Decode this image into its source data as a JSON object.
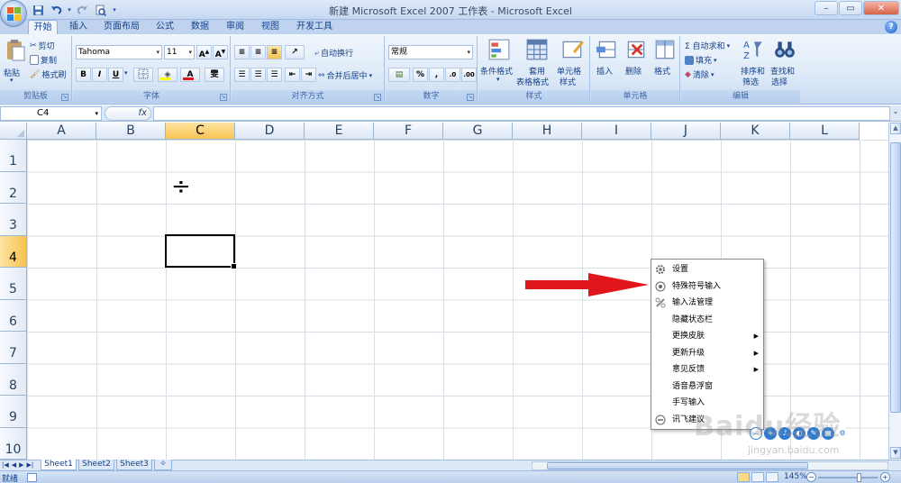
{
  "window": {
    "title": "新建 Microsoft Excel 2007 工作表 - Microsoft Excel",
    "minimize": "–",
    "restore": "▭",
    "close": "✕"
  },
  "qat": {
    "save": "💾",
    "undo": "↶",
    "redo": "↷",
    "print": "🖨",
    "customize": "▾"
  },
  "tabs": [
    {
      "label": "开始",
      "active": true
    },
    {
      "label": "插入"
    },
    {
      "label": "页面布局"
    },
    {
      "label": "公式"
    },
    {
      "label": "数据"
    },
    {
      "label": "审阅"
    },
    {
      "label": "视图"
    },
    {
      "label": "开发工具"
    }
  ],
  "ribbon": {
    "clipboard": {
      "label": "剪贴板",
      "paste": "粘贴",
      "cut": "剪切",
      "copy": "复制",
      "format_painter": "格式刷"
    },
    "font": {
      "label": "字体",
      "name": "Tahoma",
      "size": "11",
      "grow": "A^",
      "shrink": "A˅",
      "bold": "B",
      "italic": "I",
      "underline": "U",
      "wen": "雯"
    },
    "alignment": {
      "label": "对齐方式",
      "wrap": "自动换行",
      "merge": "合并后居中"
    },
    "number": {
      "label": "数字",
      "format": "常规",
      "percent": "%",
      "comma": ","
    },
    "styles": {
      "label": "样式",
      "conditional": "条件格式",
      "table_line1": "套用",
      "table_line2": "表格格式",
      "cell_line1": "单元格",
      "cell_line2": "样式"
    },
    "cells": {
      "label": "单元格",
      "insert": "插入",
      "delete": "删除",
      "format": "格式"
    },
    "editing": {
      "label": "编辑",
      "autosum": "Σ 自动求和",
      "fill": "填充",
      "clear": "清除",
      "sort_line1": "排序和",
      "sort_line2": "筛选",
      "find_line1": "查找和",
      "find_line2": "选择"
    }
  },
  "formula_bar": {
    "name_box": "C4",
    "fx": "fx",
    "value": ""
  },
  "columns": [
    "A",
    "B",
    "C",
    "D",
    "E",
    "F",
    "G",
    "H",
    "I",
    "J",
    "K",
    "L"
  ],
  "rows": [
    "1",
    "2",
    "3",
    "4",
    "5",
    "6",
    "7",
    "8",
    "9",
    "10"
  ],
  "selected_cell": {
    "column": "C",
    "row": "4"
  },
  "cell_content": {
    "C2": "÷"
  },
  "sheets": [
    {
      "label": "Sheet1",
      "active": true
    },
    {
      "label": "Sheet2"
    },
    {
      "label": "Sheet3"
    }
  ],
  "status": {
    "ready": "就绪",
    "zoom": "145%"
  },
  "context_menu": [
    {
      "label": "设置",
      "icon": "gear-icon",
      "submenu": false
    },
    {
      "label": "特殊符号输入",
      "icon": "symbol-icon",
      "submenu": false
    },
    {
      "label": "输入法管理",
      "icon": "ime-manage-icon",
      "submenu": false
    },
    {
      "label": "隐藏状态栏",
      "icon": "",
      "submenu": false
    },
    {
      "label": "更换皮肤",
      "icon": "",
      "submenu": true
    },
    {
      "label": "更新升级",
      "icon": "",
      "submenu": true
    },
    {
      "label": "意见反馈",
      "icon": "",
      "submenu": true
    },
    {
      "label": "语音悬浮窗",
      "icon": "",
      "submenu": false
    },
    {
      "label": "手写输入",
      "icon": "",
      "submenu": false
    },
    {
      "label": "讯飞建议",
      "icon": "minus-circle-icon",
      "submenu": false
    }
  ],
  "watermark": {
    "text": "Baidu经验",
    "url": "jingyan.baidu.com"
  },
  "colors": {
    "accent": "#15428b",
    "arrow": "#e0161b",
    "selected_header": "#f8c352"
  }
}
